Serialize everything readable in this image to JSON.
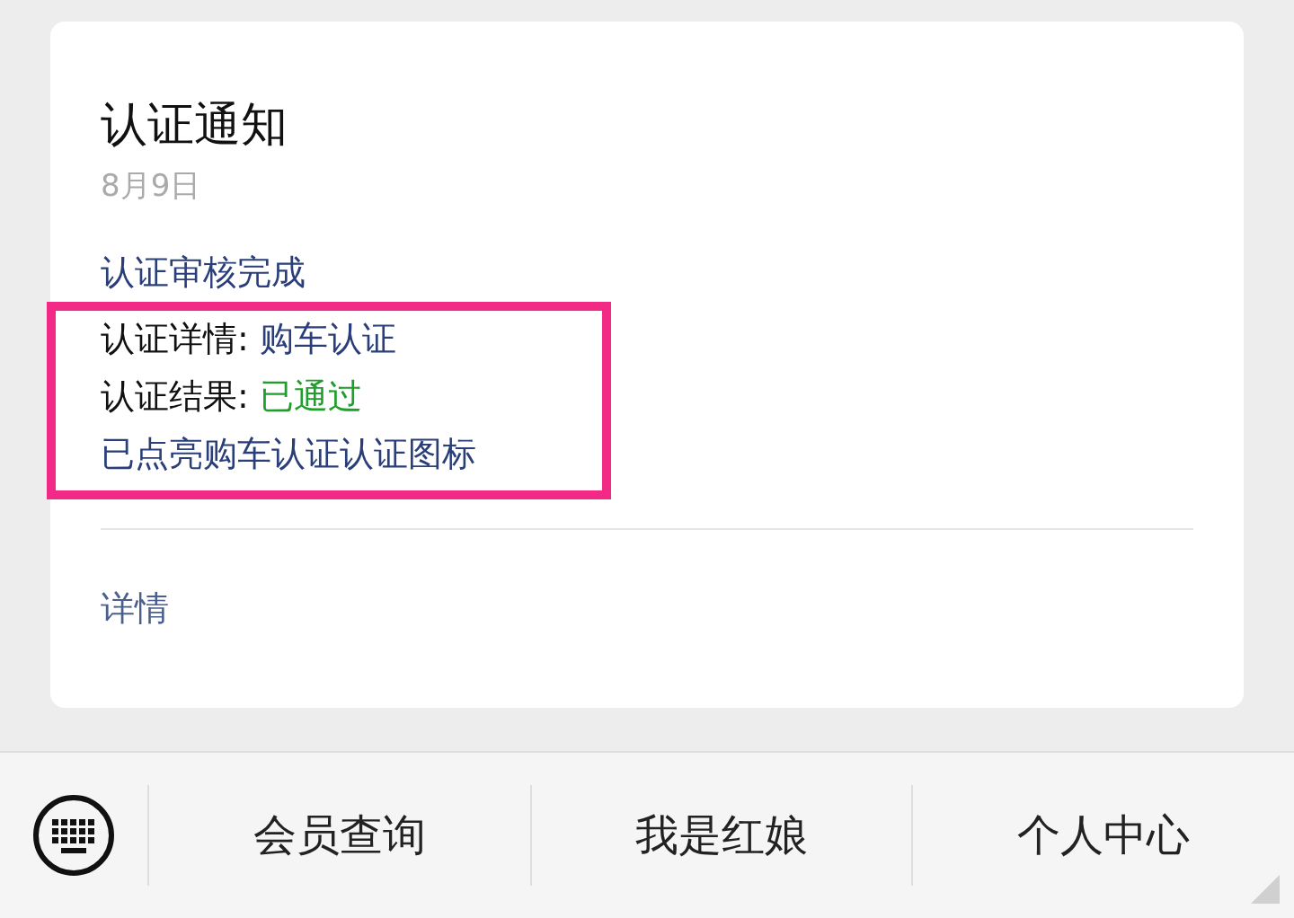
{
  "card": {
    "title": "认证通知",
    "date": "8月9日",
    "lines": [
      {
        "kind": "note",
        "text": "认证审核完成",
        "highlighted": false
      },
      {
        "kind": "field",
        "label": "认证详情:",
        "value": "购车认证",
        "color": "#2a3f7a",
        "highlighted": true
      },
      {
        "kind": "field",
        "label": "认证结果:",
        "value": "已通过",
        "color": "#1e9e2a",
        "highlighted": true
      },
      {
        "kind": "note",
        "text": "已点亮购车认证认证图标",
        "highlighted": true
      }
    ],
    "link": "详情"
  },
  "menu": [
    "会员查询",
    "我是红娘",
    "个人中心"
  ]
}
